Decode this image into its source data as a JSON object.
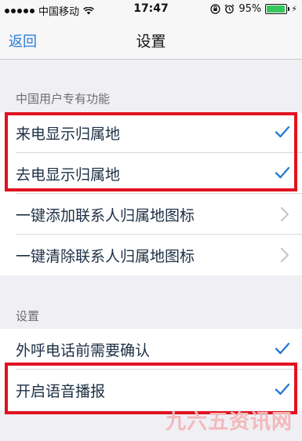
{
  "status_bar": {
    "carrier": "中国移动",
    "time": "17:47",
    "battery": "95%",
    "battery_level": 0.95,
    "signal_dots": 5
  },
  "nav": {
    "back_label": "返回",
    "title": "设置"
  },
  "sections": [
    {
      "header": "中国用户专有功能",
      "items": [
        {
          "label": "来电显示归属地",
          "accessory": "checkmark"
        },
        {
          "label": "去电显示归属地",
          "accessory": "checkmark"
        },
        {
          "label": "一键添加联系人归属地图标",
          "accessory": "chevron"
        },
        {
          "label": "一键清除联系人归属地图标",
          "accessory": "chevron"
        }
      ]
    },
    {
      "header": "设置",
      "items": [
        {
          "label": "外呼电话前需要确认",
          "accessory": "checkmark"
        },
        {
          "label": "开启语音播报",
          "accessory": "checkmark"
        }
      ]
    }
  ],
  "watermark": "九六五资讯网",
  "colors": {
    "accent": "#2a7bd6",
    "highlight": "#e0121f",
    "battery": "#35c759"
  }
}
